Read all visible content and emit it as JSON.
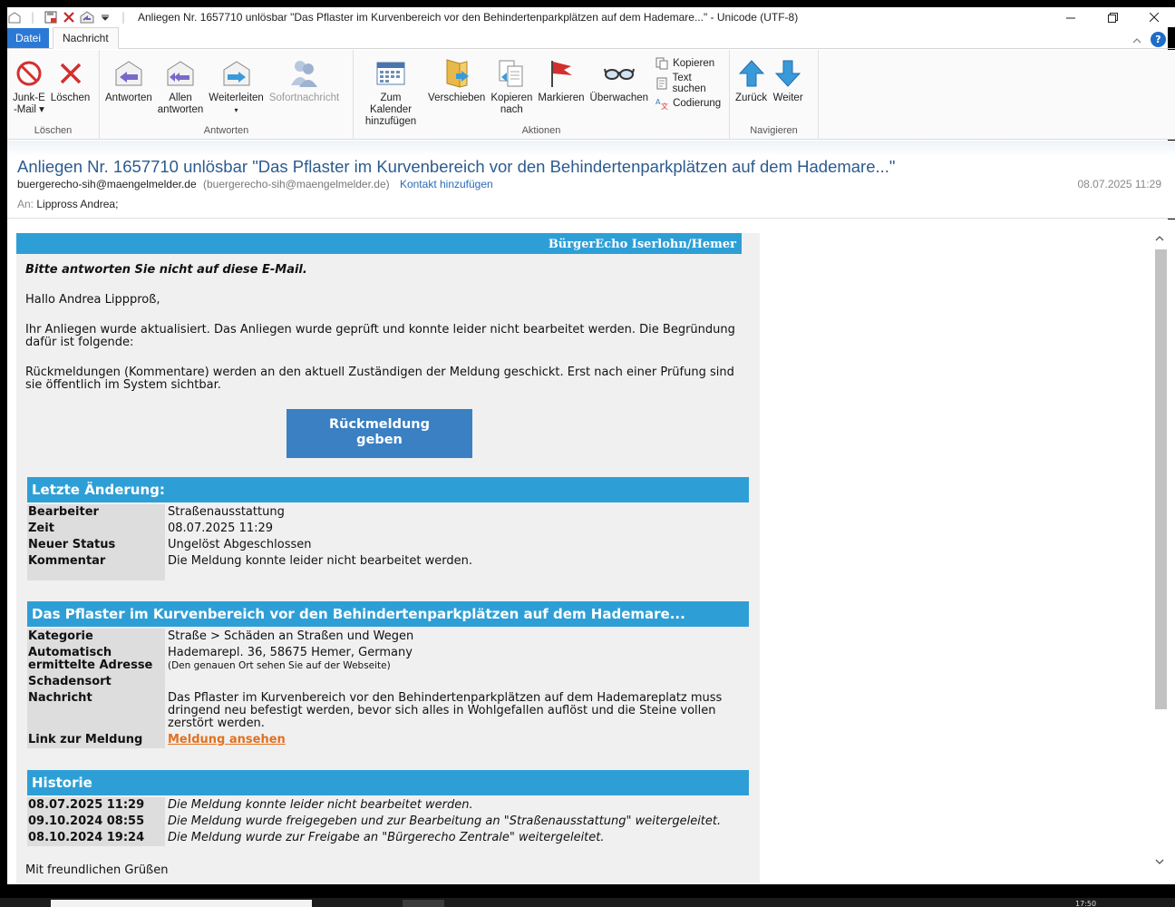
{
  "window": {
    "title": "Anliegen Nr. 1657710 unlösbar \"Das Pflaster im Kurvenbereich vor den Behindertenparkplätzen auf dem Hademare...\" - Unicode (UTF-8)"
  },
  "tabs": {
    "file": "Datei",
    "message": "Nachricht"
  },
  "ribbon": {
    "groups": {
      "delete": "Löschen",
      "respond": "Antworten",
      "actions": "Aktionen",
      "navigate": "Navigieren"
    },
    "junk_line1": "Junk-E",
    "junk_line2": "-Mail",
    "delete": "Löschen",
    "reply": "Antworten",
    "reply_all_line1": "Allen",
    "reply_all_line2": "antworten",
    "forward": "Weiterleiten",
    "instant_message": "Sofortnachricht",
    "calendar_line1": "Zum Kalender",
    "calendar_line2": "hinzufügen",
    "move": "Verschieben",
    "copy_to_line1": "Kopieren",
    "copy_to_line2": "nach",
    "flag": "Markieren",
    "watch": "Überwachen",
    "copy": "Kopieren",
    "find_text": "Text suchen",
    "encoding": "Codierung",
    "back": "Zurück",
    "next": "Weiter"
  },
  "header": {
    "subject": "Anliegen Nr. 1657710 unlösbar \"Das Pflaster im Kurvenbereich vor den Behindertenparkplätzen auf dem Hademare...\"",
    "from_name": "buergerecho-sih@maengelmelder.de",
    "from_addr": "(buergerecho-sih@maengelmelder.de)",
    "add_contact": "Kontakt hinzufügen",
    "date": "08.07.2025 11:29",
    "to_label": "An:",
    "to": "Lippross Andrea;"
  },
  "mail": {
    "banner": "BürgerEcho Iserlohn/Hemer",
    "noreply": "Bitte antworten Sie nicht auf diese E-Mail.",
    "greeting": "Hallo Andrea Lippproß,",
    "para1": "Ihr Anliegen wurde aktualisiert. Das Anliegen wurde geprüft und konnte leider nicht bearbeitet werden. Die Begründung dafür ist folgende:",
    "para2": "Rückmeldungen (Kommentare) werden an den aktuell Zuständigen der Meldung geschickt. Erst nach einer Prüfung sind sie öffentlich im System sichtbar.",
    "cta_line1": "Rückmeldung",
    "cta_line2": "geben",
    "last_change": {
      "title": "Letzte Änderung:",
      "rows": [
        {
          "k": "Bearbeiter",
          "v": "Straßenausstattung"
        },
        {
          "k": "Zeit",
          "v": "08.07.2025 11:29"
        },
        {
          "k": "Neuer Status",
          "v": "Ungelöst Abgeschlossen"
        },
        {
          "k": "Kommentar",
          "v": "Die Meldung konnte leider nicht bearbeitet werden."
        }
      ]
    },
    "report": {
      "title": "Das Pflaster im Kurvenbereich vor den Behindertenparkplätzen auf dem Hademare...",
      "category_k": "Kategorie",
      "category_v": "Straße > Schäden an Straßen und Wegen",
      "address_k": "Automatisch ermittelte Adresse",
      "address_v": "Hademarepl. 36, 58675 Hemer, Germany",
      "address_note": "(Den genauen Ort sehen Sie auf der Webseite)",
      "damage_k": "Schadensort",
      "damage_v": "",
      "message_k": "Nachricht",
      "message_v": "Das Pflaster im Kurvenbereich vor den Behindertenparkplätzen auf dem Hademareplatz muss dringend neu befestigt werden, bevor sich alles in Wohlgefallen auflöst und die Steine vollen zerstört werden.",
      "link_k": "Link zur Meldung",
      "link_v": "Meldung ansehen"
    },
    "history": {
      "title": "Historie",
      "rows": [
        {
          "k": "08.07.2025 11:29",
          "v": "Die Meldung konnte leider nicht bearbeitet werden."
        },
        {
          "k": "09.10.2024 08:55",
          "v": "Die Meldung wurde freigegeben und zur Bearbeitung an \"Straßenausstattung\" weitergeleitet."
        },
        {
          "k": "08.10.2024 19:24",
          "v": "Die Meldung wurde zur Freigabe an \"Bürgerecho Zentrale\" weitergeleitet."
        }
      ]
    },
    "closing": "Mit freundlichen Grüßen"
  },
  "taskbar": {
    "clock": "17:50"
  },
  "colors": {
    "accent": "#2e9fd6",
    "cta": "#3a80c2",
    "link": "#e3701e",
    "subject": "#2c5b8f"
  }
}
